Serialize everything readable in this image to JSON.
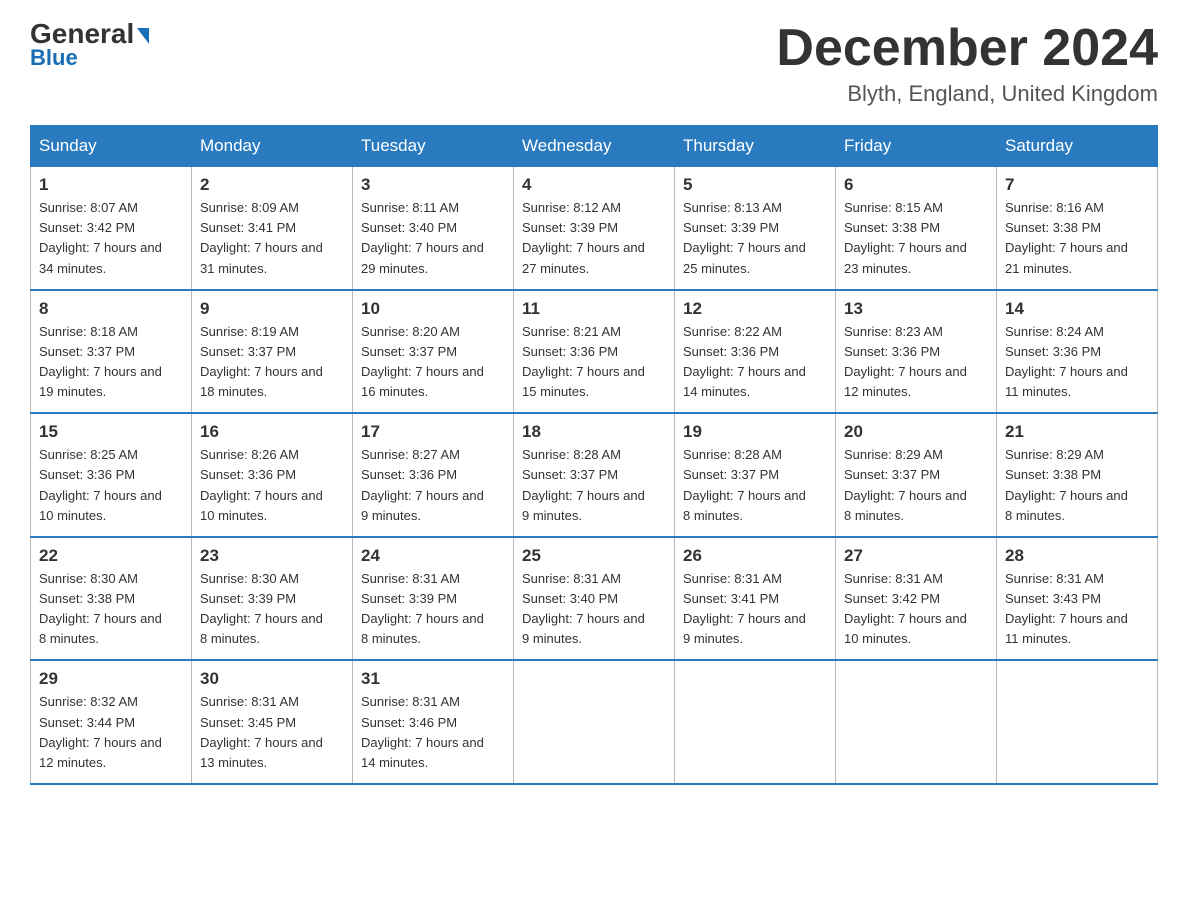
{
  "header": {
    "logo_general": "General",
    "logo_blue": "Blue",
    "month_title": "December 2024",
    "location": "Blyth, England, United Kingdom"
  },
  "days_of_week": [
    "Sunday",
    "Monday",
    "Tuesday",
    "Wednesday",
    "Thursday",
    "Friday",
    "Saturday"
  ],
  "weeks": [
    [
      {
        "day": "1",
        "sunrise": "8:07 AM",
        "sunset": "3:42 PM",
        "daylight": "7 hours and 34 minutes."
      },
      {
        "day": "2",
        "sunrise": "8:09 AM",
        "sunset": "3:41 PM",
        "daylight": "7 hours and 31 minutes."
      },
      {
        "day": "3",
        "sunrise": "8:11 AM",
        "sunset": "3:40 PM",
        "daylight": "7 hours and 29 minutes."
      },
      {
        "day": "4",
        "sunrise": "8:12 AM",
        "sunset": "3:39 PM",
        "daylight": "7 hours and 27 minutes."
      },
      {
        "day": "5",
        "sunrise": "8:13 AM",
        "sunset": "3:39 PM",
        "daylight": "7 hours and 25 minutes."
      },
      {
        "day": "6",
        "sunrise": "8:15 AM",
        "sunset": "3:38 PM",
        "daylight": "7 hours and 23 minutes."
      },
      {
        "day": "7",
        "sunrise": "8:16 AM",
        "sunset": "3:38 PM",
        "daylight": "7 hours and 21 minutes."
      }
    ],
    [
      {
        "day": "8",
        "sunrise": "8:18 AM",
        "sunset": "3:37 PM",
        "daylight": "7 hours and 19 minutes."
      },
      {
        "day": "9",
        "sunrise": "8:19 AM",
        "sunset": "3:37 PM",
        "daylight": "7 hours and 18 minutes."
      },
      {
        "day": "10",
        "sunrise": "8:20 AM",
        "sunset": "3:37 PM",
        "daylight": "7 hours and 16 minutes."
      },
      {
        "day": "11",
        "sunrise": "8:21 AM",
        "sunset": "3:36 PM",
        "daylight": "7 hours and 15 minutes."
      },
      {
        "day": "12",
        "sunrise": "8:22 AM",
        "sunset": "3:36 PM",
        "daylight": "7 hours and 14 minutes."
      },
      {
        "day": "13",
        "sunrise": "8:23 AM",
        "sunset": "3:36 PM",
        "daylight": "7 hours and 12 minutes."
      },
      {
        "day": "14",
        "sunrise": "8:24 AM",
        "sunset": "3:36 PM",
        "daylight": "7 hours and 11 minutes."
      }
    ],
    [
      {
        "day": "15",
        "sunrise": "8:25 AM",
        "sunset": "3:36 PM",
        "daylight": "7 hours and 10 minutes."
      },
      {
        "day": "16",
        "sunrise": "8:26 AM",
        "sunset": "3:36 PM",
        "daylight": "7 hours and 10 minutes."
      },
      {
        "day": "17",
        "sunrise": "8:27 AM",
        "sunset": "3:36 PM",
        "daylight": "7 hours and 9 minutes."
      },
      {
        "day": "18",
        "sunrise": "8:28 AM",
        "sunset": "3:37 PM",
        "daylight": "7 hours and 9 minutes."
      },
      {
        "day": "19",
        "sunrise": "8:28 AM",
        "sunset": "3:37 PM",
        "daylight": "7 hours and 8 minutes."
      },
      {
        "day": "20",
        "sunrise": "8:29 AM",
        "sunset": "3:37 PM",
        "daylight": "7 hours and 8 minutes."
      },
      {
        "day": "21",
        "sunrise": "8:29 AM",
        "sunset": "3:38 PM",
        "daylight": "7 hours and 8 minutes."
      }
    ],
    [
      {
        "day": "22",
        "sunrise": "8:30 AM",
        "sunset": "3:38 PM",
        "daylight": "7 hours and 8 minutes."
      },
      {
        "day": "23",
        "sunrise": "8:30 AM",
        "sunset": "3:39 PM",
        "daylight": "7 hours and 8 minutes."
      },
      {
        "day": "24",
        "sunrise": "8:31 AM",
        "sunset": "3:39 PM",
        "daylight": "7 hours and 8 minutes."
      },
      {
        "day": "25",
        "sunrise": "8:31 AM",
        "sunset": "3:40 PM",
        "daylight": "7 hours and 9 minutes."
      },
      {
        "day": "26",
        "sunrise": "8:31 AM",
        "sunset": "3:41 PM",
        "daylight": "7 hours and 9 minutes."
      },
      {
        "day": "27",
        "sunrise": "8:31 AM",
        "sunset": "3:42 PM",
        "daylight": "7 hours and 10 minutes."
      },
      {
        "day": "28",
        "sunrise": "8:31 AM",
        "sunset": "3:43 PM",
        "daylight": "7 hours and 11 minutes."
      }
    ],
    [
      {
        "day": "29",
        "sunrise": "8:32 AM",
        "sunset": "3:44 PM",
        "daylight": "7 hours and 12 minutes."
      },
      {
        "day": "30",
        "sunrise": "8:31 AM",
        "sunset": "3:45 PM",
        "daylight": "7 hours and 13 minutes."
      },
      {
        "day": "31",
        "sunrise": "8:31 AM",
        "sunset": "3:46 PM",
        "daylight": "7 hours and 14 minutes."
      },
      null,
      null,
      null,
      null
    ]
  ]
}
